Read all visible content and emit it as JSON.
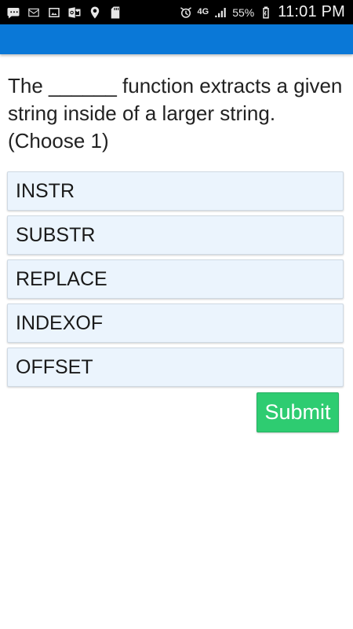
{
  "status_bar": {
    "left_icons": [
      "chat-icon",
      "mail-icon",
      "gallery-icon",
      "outlook-icon",
      "maps-icon",
      "sd-card-icon"
    ],
    "right_icons": [
      "alarm-icon",
      "network-icon",
      "signal-icon",
      "battery-icon"
    ],
    "network_label": "4G",
    "battery": "55%",
    "time": "11:01 PM"
  },
  "app_bar": {
    "color": "#0a78d7"
  },
  "quiz": {
    "question": "The ______ function extracts a given string inside of a larger string. (Choose 1)",
    "options": [
      "INSTR",
      "SUBSTR",
      "REPLACE",
      "INDEXOF",
      "OFFSET"
    ],
    "submit_label": "Submit"
  },
  "colors": {
    "option_background": "#ebf4fd",
    "submit_background": "#2ecc71"
  }
}
